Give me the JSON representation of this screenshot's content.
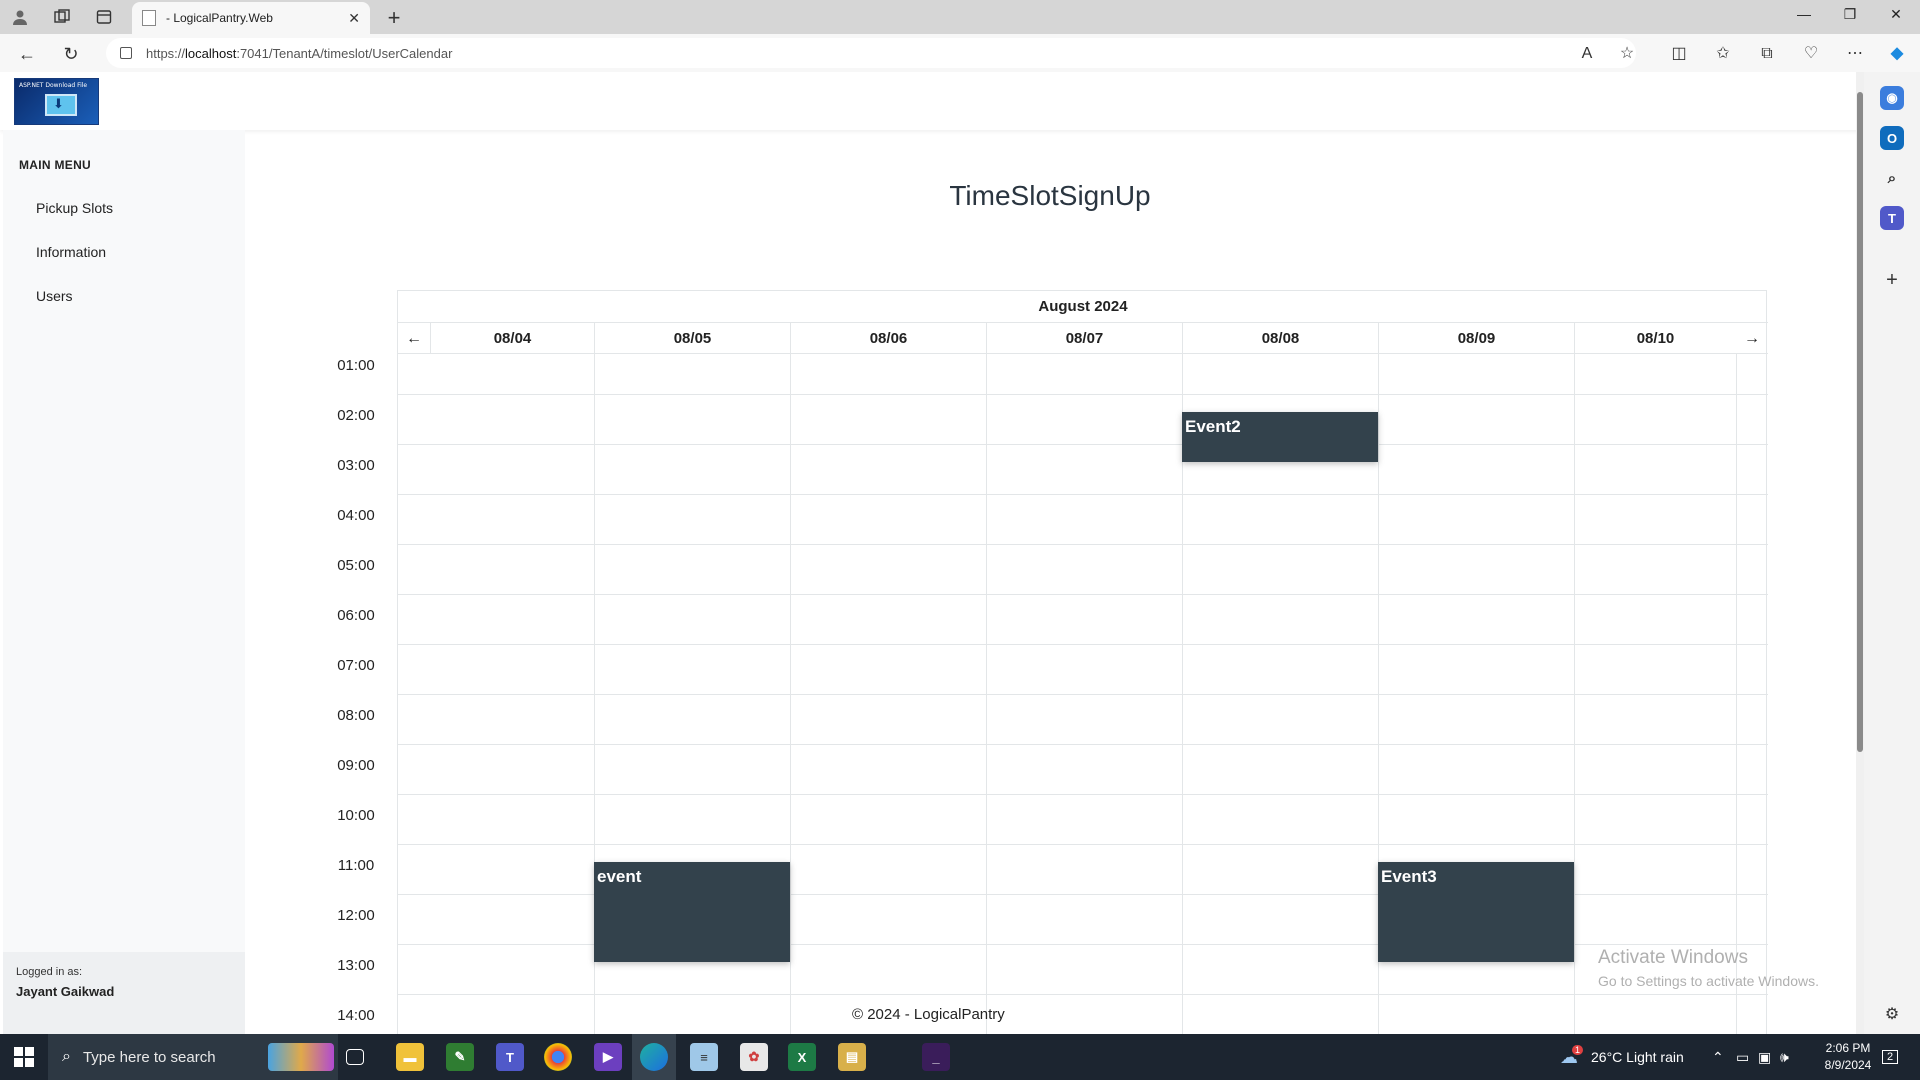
{
  "browser": {
    "tab_title": "- LogicalPantry.Web",
    "url_prefix": "https://",
    "url_host": "localhost",
    "url_rest": ":7041/TenantA/timeslot/UserCalendar"
  },
  "sidebar": {
    "menu_title": "MAIN MENU",
    "items": [
      {
        "label": "Pickup Slots"
      },
      {
        "label": "Information"
      },
      {
        "label": "Users"
      }
    ],
    "logged_in_label": "Logged in as:",
    "logged_in_user": "Jayant Gaikwad"
  },
  "logo": {
    "text": "ASP.NET Download File"
  },
  "page": {
    "title": "TimeSlotSignUp"
  },
  "calendar": {
    "month": "August 2024",
    "prev_label": "←",
    "next_label": "→",
    "days": [
      "08/04",
      "08/05",
      "08/06",
      "08/07",
      "08/08",
      "08/09",
      "08/10"
    ],
    "hours": [
      "01:00",
      "02:00",
      "03:00",
      "04:00",
      "05:00",
      "06:00",
      "07:00",
      "08:00",
      "09:00",
      "10:00",
      "11:00",
      "12:00",
      "13:00",
      "14:00"
    ],
    "events": [
      {
        "title": "Event2",
        "day": "08/08",
        "start": "01:45",
        "end": "02:45"
      },
      {
        "title": "event",
        "day": "08/05",
        "start": "10:45",
        "end": "12:45"
      },
      {
        "title": "Event3",
        "day": "08/09",
        "start": "10:45",
        "end": "12:45"
      }
    ]
  },
  "footer": {
    "text": "© 2024 - LogicalPantry"
  },
  "watermark": {
    "line1": "Activate Windows",
    "line2": "Go to Settings to activate Windows."
  },
  "taskbar": {
    "search_placeholder": "Type here to search",
    "weather": "26°C  Light rain",
    "weather_badge": "1",
    "time": "2:06 PM",
    "date": "8/9/2024",
    "notification_count": "2"
  }
}
